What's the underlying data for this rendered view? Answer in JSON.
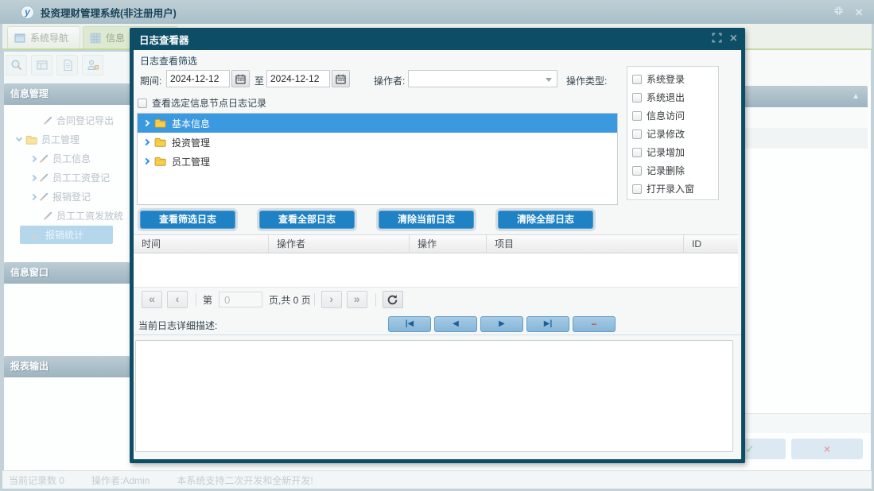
{
  "window": {
    "icon_letter": "y",
    "title": "投资理财管理系统(非注册用户)"
  },
  "icons": {
    "close": "×",
    "collapse": "▲",
    "confirm": "✓",
    "cancel": "×",
    "pager_first": "«",
    "pager_prev": "‹",
    "pager_next": "›",
    "pager_last": "»",
    "rec_first": "|◀",
    "rec_prev": "◀",
    "rec_next": "▶",
    "rec_last": "▶|",
    "rec_remove": "−"
  },
  "tabs": {
    "system_nav": "系统导航",
    "info": "信息"
  },
  "sidebar": {
    "panels": {
      "info": "信息管理",
      "window": "信息窗口",
      "report": "报表输出"
    },
    "tree": {
      "contract_export": "合同登记导出",
      "staff_mgmt": "员工管理",
      "staff_info": "员工信息",
      "staff_salary": "员工工资登记",
      "expense_reg": "报销登记",
      "salary_grant": "员工工资发放统",
      "expense_stats": "报销统计"
    }
  },
  "statusbar": {
    "records": "当前记录数 0",
    "operator": "操作者:Admin",
    "message": "本系统支持二次开发和全新开发!"
  },
  "dialog": {
    "title": "日志查看器",
    "filter_label": "日志查看筛选",
    "period_label": "期间:",
    "date_from": "2024-12-12",
    "to_label": "至",
    "date_to": "2024-12-12",
    "operator_label": "操作者:",
    "operator_value": "",
    "type_label": "操作类型:",
    "types": [
      "系统登录",
      "系统退出",
      "信息访问",
      "记录修改",
      "记录增加",
      "记录删除",
      "打开录入窗"
    ],
    "node_filter_label": "查看选定信息节点日志记录",
    "tree": [
      "基本信息",
      "投资管理",
      "员工管理"
    ],
    "buttons": [
      "查看筛选日志",
      "查看全部日志",
      "清除当前日志",
      "清除全部日志"
    ],
    "columns": [
      "时间",
      "操作者",
      "操作",
      "项目",
      "ID"
    ],
    "pager": {
      "page_prefix": "第",
      "page_value": "0",
      "page_suffix": "页,共 0 页"
    },
    "detail_label": "当前日志详细描述:"
  },
  "colors": {
    "dialog_header": "#0d4e66",
    "selection_blue": "#3b99e0",
    "action_button_blue": "#1e82c4",
    "tab_underline_green": "#c2db9f",
    "panel_header": "#a9bfc9"
  }
}
